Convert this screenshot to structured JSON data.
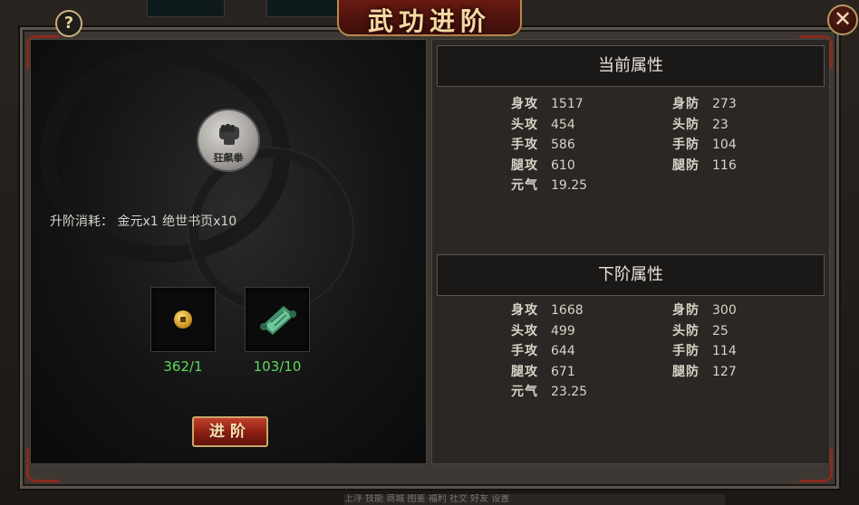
{
  "dialog": {
    "title": "武功进阶",
    "help_label": "?",
    "close_label": "✕"
  },
  "background": {
    "bottom_text": "上浮 技能 商城 图鉴 福利 社交 好友 设置"
  },
  "skill": {
    "name": "狂飙拳",
    "icon": "fist-icon"
  },
  "cost": {
    "text": "升阶消耗： 金元x1 绝世书页x10"
  },
  "materials": [
    {
      "name": "金元",
      "icon": "gold-coin-icon",
      "count": "362/1"
    },
    {
      "name": "绝世书页",
      "icon": "scroll-icon",
      "count": "103/10"
    }
  ],
  "advance_button": {
    "label": "进阶"
  },
  "current_attributes": {
    "title": "当前属性",
    "left": [
      {
        "label": "身攻",
        "value": "1517"
      },
      {
        "label": "头攻",
        "value": "454"
      },
      {
        "label": "手攻",
        "value": "586"
      },
      {
        "label": "腿攻",
        "value": "610"
      },
      {
        "label": "元气",
        "value": "19.25"
      }
    ],
    "right": [
      {
        "label": "身防",
        "value": "273"
      },
      {
        "label": "头防",
        "value": "23"
      },
      {
        "label": "手防",
        "value": "104"
      },
      {
        "label": "腿防",
        "value": "116"
      }
    ]
  },
  "next_attributes": {
    "title": "下阶属性",
    "left": [
      {
        "label": "身攻",
        "value": "1668"
      },
      {
        "label": "头攻",
        "value": "499"
      },
      {
        "label": "手攻",
        "value": "644"
      },
      {
        "label": "腿攻",
        "value": "671"
      },
      {
        "label": "元气",
        "value": "23.25"
      }
    ],
    "right": [
      {
        "label": "身防",
        "value": "300"
      },
      {
        "label": "头防",
        "value": "25"
      },
      {
        "label": "手防",
        "value": "114"
      },
      {
        "label": "腿防",
        "value": "127"
      }
    ]
  },
  "colors": {
    "count_green": "#5ed85e",
    "title_gold": "#f4d9a4",
    "button_red": "#8a1e12"
  }
}
